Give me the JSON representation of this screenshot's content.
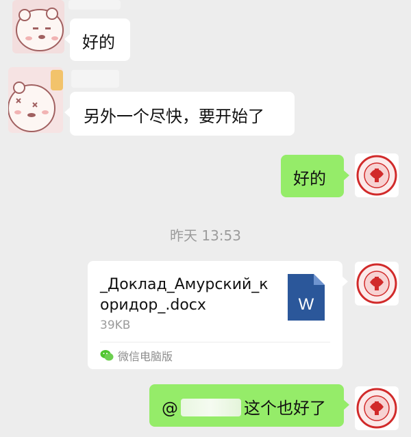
{
  "chat": {
    "messages": [
      {
        "direction": "in",
        "text": "好的"
      },
      {
        "direction": "in",
        "text": "另外一个尽快，要开始了"
      },
      {
        "direction": "out",
        "text": "好的"
      }
    ],
    "timestamp": "昨天 13:53",
    "file_message": {
      "direction": "out",
      "file_name": "_Доклад_Амурский_коридор_.docx",
      "file_size": "39KB",
      "file_type_icon": "word-doc-icon",
      "file_type_letter": "W",
      "source_label": "微信电脑版"
    },
    "last_message": {
      "direction": "out",
      "mention_prefix": "@",
      "text_after_mention": "这个也好了"
    }
  },
  "colors": {
    "background": "#ededed",
    "incoming_bubble": "#ffffff",
    "outgoing_bubble": "#95ec69",
    "word_blue": "#2b579a",
    "seal_red": "#d12a2a"
  }
}
